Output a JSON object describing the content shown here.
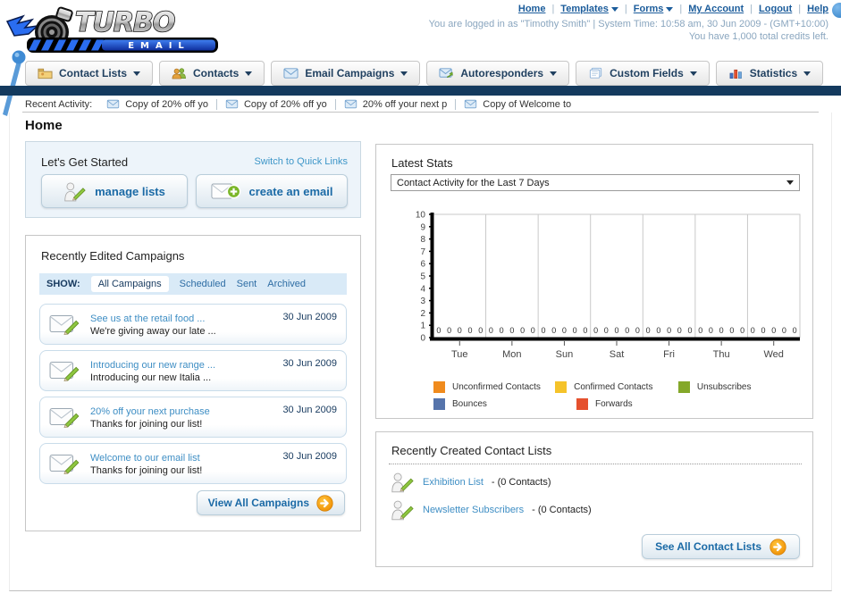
{
  "header": {
    "logo": {
      "title": "TURBO",
      "subtitle": "EMAIL"
    },
    "nav": [
      {
        "label": "Home",
        "dropdown": false
      },
      {
        "label": "Templates",
        "dropdown": true
      },
      {
        "label": "Forms",
        "dropdown": true
      },
      {
        "label": "My Account",
        "dropdown": false
      },
      {
        "label": "Logout",
        "dropdown": false
      },
      {
        "label": "Help",
        "dropdown": false
      }
    ],
    "login_line1": "You are logged in as \"Timothy Smith\" | System Time: 10:58 am, 30 Jun 2009 - (GMT+10:00)",
    "login_line2": "You have 1,000 total credits left."
  },
  "tabs": [
    {
      "label": "Contact Lists"
    },
    {
      "label": "Contacts"
    },
    {
      "label": "Email Campaigns"
    },
    {
      "label": "Autoresponders"
    },
    {
      "label": "Custom Fields"
    },
    {
      "label": "Statistics"
    }
  ],
  "recent_activity": {
    "label": "Recent Activity:",
    "items": [
      "Copy of 20% off yo",
      "Copy of 20% off yo",
      "20% off your next p",
      "Copy of Welcome to"
    ]
  },
  "page_title": "Home",
  "get_started": {
    "title": "Let's Get Started",
    "switch_link": "Switch to Quick Links",
    "manage_lists_label": "manage lists",
    "create_email_label": "create an email"
  },
  "campaigns_panel": {
    "title": "Recently Edited Campaigns",
    "show_label": "SHOW:",
    "filters": [
      "All Campaigns",
      "Scheduled",
      "Sent",
      "Archived"
    ],
    "active_filter": "All Campaigns",
    "items": [
      {
        "title": "See us at the retail food ...",
        "subtitle": "We're giving away our late ...",
        "date": "30 Jun 2009"
      },
      {
        "title": "Introducing our new range ...",
        "subtitle": "Introducing our new Italia ...",
        "date": "30 Jun 2009"
      },
      {
        "title": "20% off your next purchase",
        "subtitle": "Thanks for joining our list!",
        "date": "30 Jun 2009"
      },
      {
        "title": "Welcome to our email list",
        "subtitle": "Thanks for joining our list!",
        "date": "30 Jun 2009"
      }
    ],
    "view_all_label": "View All Campaigns"
  },
  "stats_panel": {
    "title": "Latest Stats",
    "dropdown_value": "Contact Activity for the Last 7 Days",
    "chart_data": {
      "type": "bar",
      "title": "Contact Activity for the Last 7 Days",
      "categories": [
        "Tue",
        "Mon",
        "Sun",
        "Sat",
        "Fri",
        "Thu",
        "Wed"
      ],
      "series": [
        {
          "name": "Unconfirmed Contacts",
          "color": "#f08b1d",
          "values": [
            0,
            0,
            0,
            0,
            0,
            0,
            0
          ]
        },
        {
          "name": "Confirmed Contacts",
          "color": "#f5c32a",
          "values": [
            0,
            0,
            0,
            0,
            0,
            0,
            0
          ]
        },
        {
          "name": "Unsubscribes",
          "color": "#84a82a",
          "values": [
            0,
            0,
            0,
            0,
            0,
            0,
            0
          ]
        },
        {
          "name": "Bounces",
          "color": "#5674ab",
          "values": [
            0,
            0,
            0,
            0,
            0,
            0,
            0
          ]
        },
        {
          "name": "Forwards",
          "color": "#e5512e",
          "values": [
            0,
            0,
            0,
            0,
            0,
            0,
            0
          ]
        }
      ],
      "ylim": [
        0,
        10
      ],
      "yticks": [
        0,
        1,
        2,
        3,
        4,
        5,
        6,
        7,
        8,
        9,
        10
      ],
      "grid": "vertical group separators, plot box top/right thin gray, thick black left and bottom axes",
      "value_labels": "each bar labeled 0 above baseline",
      "legend_position": "bottom"
    }
  },
  "contact_lists_panel": {
    "title": "Recently Created Contact Lists",
    "items": [
      {
        "name": "Exhibition List",
        "detail": "- (0 Contacts)"
      },
      {
        "name": "Newsletter Subscribers",
        "detail": "- (0 Contacts)"
      }
    ],
    "see_all_label": "See All Contact Lists"
  },
  "colors": {
    "navy_bar": "#143a5e",
    "link_blue": "#1b5c9b",
    "panel_link_blue": "#3e8ec4",
    "button_text_blue": "#1b6aa6",
    "accent_orange": "#f59b0f"
  }
}
